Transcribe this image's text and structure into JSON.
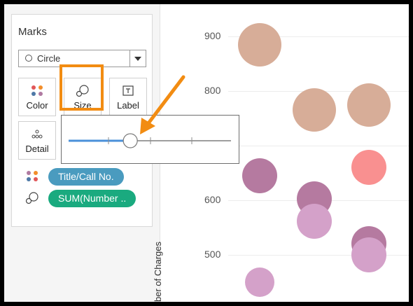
{
  "marks_card": {
    "title": "Marks",
    "mark_type": "Circle",
    "buttons": {
      "color": "Color",
      "size": "Size",
      "label": "Label",
      "detail": "Detail"
    },
    "fields": [
      {
        "label": "Title/Call No.",
        "color": "#4a9bbf",
        "icon": "color-dots-icon"
      },
      {
        "label": "SUM(Number ..",
        "color": "#1aaa7f",
        "icon": "size-icon"
      }
    ]
  },
  "size_slider": {
    "value_fraction": 0.38
  },
  "chart": {
    "ylabel": "ber of Charges",
    "yticks": [
      "900",
      "800",
      "600",
      "500"
    ]
  },
  "chart_data": {
    "type": "scatter",
    "ylabel": "ber of Charges",
    "yticks": [
      900,
      800,
      600,
      500
    ],
    "ylim": [
      410,
      960
    ],
    "points": [
      {
        "col": 0,
        "y": 885,
        "color": "#d7ad98",
        "size": "large"
      },
      {
        "col": 1,
        "y": 765,
        "color": "#d7ad98",
        "size": "large"
      },
      {
        "col": 2,
        "y": 775,
        "color": "#d7ad98",
        "size": "large"
      },
      {
        "col": 2,
        "y": 660,
        "color": "#f99090",
        "size": "medium"
      },
      {
        "col": 0,
        "y": 645,
        "color": "#b57aa0",
        "size": "medium"
      },
      {
        "col": 1,
        "y": 602,
        "color": "#b57aa0",
        "size": "medium"
      },
      {
        "col": 1,
        "y": 562,
        "color": "#d4a1c9",
        "size": "medium"
      },
      {
        "col": 2,
        "y": 520,
        "color": "#b57aa0",
        "size": "medium"
      },
      {
        "col": 2,
        "y": 500,
        "color": "#d4a1c9",
        "size": "medium"
      },
      {
        "col": 0,
        "y": 450,
        "color": "#d4a1c9",
        "size": "small"
      }
    ]
  }
}
